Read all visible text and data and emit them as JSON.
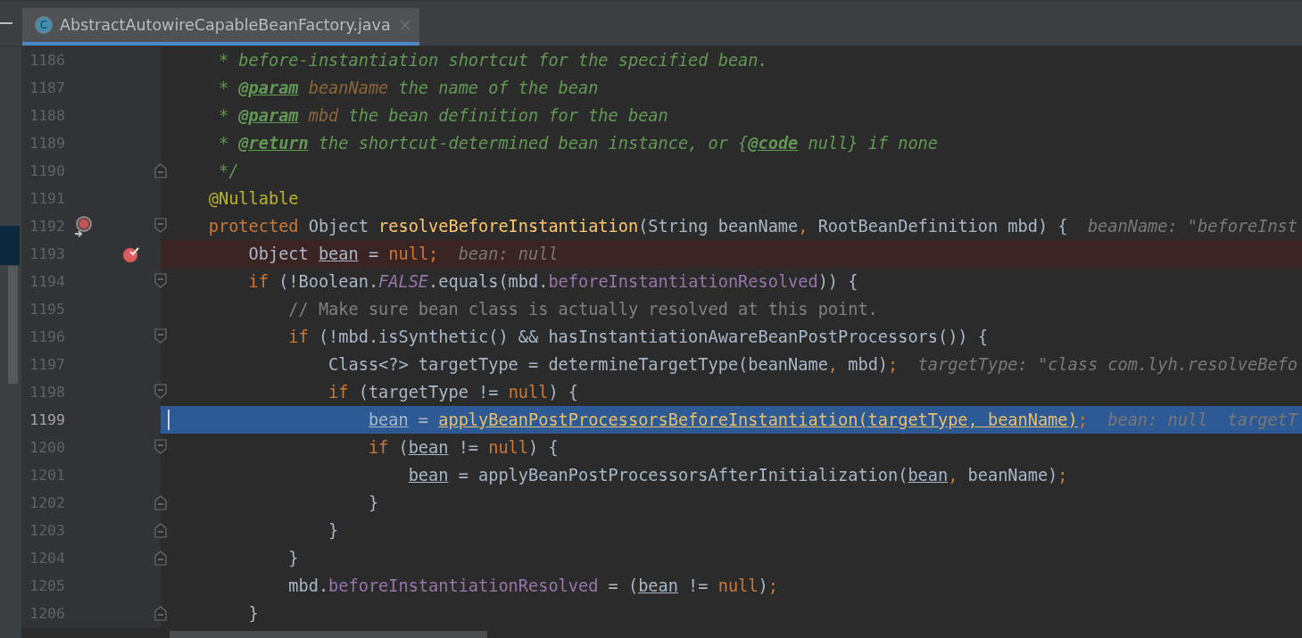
{
  "tabs": [
    {
      "label": "AbstractAutowireCapableBeanFactory.java",
      "icon_letter": "C",
      "selected": true
    }
  ],
  "lines": [
    {
      "number": "1186",
      "fold_start": false,
      "fold_end": false,
      "method_breakpoint": false,
      "breakpoint": false,
      "execution_point": false,
      "code": [
        {
          "t": "     * before-instantiation shortcut for the specified bean.",
          "kind": "doc"
        }
      ]
    },
    {
      "number": "1187",
      "fold_start": false,
      "fold_end": false,
      "method_breakpoint": false,
      "breakpoint": false,
      "execution_point": false,
      "code": [
        {
          "t": "     * ",
          "kind": "doc"
        },
        {
          "t": "@param",
          "kind": "tag"
        },
        {
          "t": " beanName",
          "kind": "docparam"
        },
        {
          "t": " the name of the bean",
          "kind": "doc"
        }
      ]
    },
    {
      "number": "1188",
      "fold_start": false,
      "fold_end": false,
      "method_breakpoint": false,
      "breakpoint": false,
      "execution_point": false,
      "code": [
        {
          "t": "     * ",
          "kind": "doc"
        },
        {
          "t": "@param",
          "kind": "tag"
        },
        {
          "t": " mbd",
          "kind": "docparam"
        },
        {
          "t": " the bean definition for the bean",
          "kind": "doc"
        }
      ]
    },
    {
      "number": "1189",
      "fold_start": false,
      "fold_end": false,
      "method_breakpoint": false,
      "breakpoint": false,
      "execution_point": false,
      "code": [
        {
          "t": "     * ",
          "kind": "doc"
        },
        {
          "t": "@return",
          "kind": "tag"
        },
        {
          "t": " the shortcut-determined bean instance, or {",
          "kind": "doc"
        },
        {
          "t": "@code",
          "kind": "tag"
        },
        {
          "t": " null} if none",
          "kind": "doc"
        }
      ]
    },
    {
      "number": "1190",
      "fold_start": false,
      "fold_end": true,
      "method_breakpoint": false,
      "breakpoint": false,
      "execution_point": false,
      "code": [
        {
          "t": "     */",
          "kind": "doc"
        }
      ]
    },
    {
      "number": "1191",
      "fold_start": false,
      "fold_end": false,
      "method_breakpoint": false,
      "breakpoint": false,
      "execution_point": false,
      "code": [
        {
          "t": "    @Nullable",
          "kind": "annot"
        }
      ]
    },
    {
      "number": "1192",
      "fold_start": true,
      "fold_end": false,
      "method_breakpoint": true,
      "breakpoint": false,
      "execution_point": false,
      "hint": "beanName: \"beforeInst",
      "code": [
        {
          "t": "    protected",
          "kind": "kw"
        },
        {
          "t": " Object ",
          "kind": "plain"
        },
        {
          "t": "resolveBeforeInstantiation",
          "kind": "decl"
        },
        {
          "t": "(String beanName",
          "kind": "plain"
        },
        {
          "t": ",",
          "kind": "kw"
        },
        {
          "t": " RootBeanDefinition mbd) {",
          "kind": "plain"
        }
      ]
    },
    {
      "number": "1193",
      "fold_start": false,
      "fold_end": false,
      "method_breakpoint": false,
      "breakpoint": true,
      "execution_point": false,
      "hint": "bean: null",
      "code": [
        {
          "t": "        Object ",
          "kind": "plain"
        },
        {
          "t": "bean",
          "kind": "var"
        },
        {
          "t": " = ",
          "kind": "plain"
        },
        {
          "t": "null;",
          "kind": "kw"
        }
      ]
    },
    {
      "number": "1194",
      "fold_start": true,
      "fold_end": false,
      "method_breakpoint": false,
      "breakpoint": false,
      "execution_point": false,
      "code": [
        {
          "t": "        if",
          "kind": "kw"
        },
        {
          "t": " (!Boolean.",
          "kind": "plain"
        },
        {
          "t": "FALSE",
          "kind": "static"
        },
        {
          "t": ".equals(mbd.",
          "kind": "plain"
        },
        {
          "t": "beforeInstantiationResolved",
          "kind": "field"
        },
        {
          "t": ")) {",
          "kind": "plain"
        }
      ]
    },
    {
      "number": "1195",
      "fold_start": false,
      "fold_end": false,
      "method_breakpoint": false,
      "breakpoint": false,
      "execution_point": false,
      "code": [
        {
          "t": "            // Make sure bean class is actually resolved at this point.",
          "kind": "comment"
        }
      ]
    },
    {
      "number": "1196",
      "fold_start": true,
      "fold_end": false,
      "method_breakpoint": false,
      "breakpoint": false,
      "execution_point": false,
      "code": [
        {
          "t": "            if",
          "kind": "kw"
        },
        {
          "t": " (!mbd.isSynthetic() && hasInstantiationAwareBeanPostProcessors()) {",
          "kind": "plain"
        }
      ]
    },
    {
      "number": "1197",
      "fold_start": false,
      "fold_end": false,
      "method_breakpoint": false,
      "breakpoint": false,
      "execution_point": false,
      "hint": "targetType: \"class com.lyh.resolveBefo",
      "code": [
        {
          "t": "                Class<?> targetType = determineTargetType(beanName",
          "kind": "plain"
        },
        {
          "t": ",",
          "kind": "kw"
        },
        {
          "t": " mbd)",
          "kind": "plain"
        },
        {
          "t": ";",
          "kind": "kw"
        }
      ]
    },
    {
      "number": "1198",
      "fold_start": true,
      "fold_end": false,
      "method_breakpoint": false,
      "breakpoint": false,
      "execution_point": false,
      "code": [
        {
          "t": "                if",
          "kind": "kw"
        },
        {
          "t": " (targetType != ",
          "kind": "plain"
        },
        {
          "t": "null",
          "kind": "kw"
        },
        {
          "t": ") {",
          "kind": "plain"
        }
      ]
    },
    {
      "number": "1199",
      "fold_start": false,
      "fold_end": false,
      "method_breakpoint": false,
      "breakpoint": false,
      "execution_point": true,
      "hint": "bean: null  targetT",
      "code": [
        {
          "t": "                    bean",
          "kind": "var"
        },
        {
          "t": " = ",
          "kind": "plain"
        },
        {
          "t": "applyBeanPostProcessorsBeforeInstantiation(targetType, beanName)",
          "kind": "target"
        },
        {
          "t": ";",
          "kind": "kw"
        }
      ]
    },
    {
      "number": "1200",
      "fold_start": true,
      "fold_end": false,
      "method_breakpoint": false,
      "breakpoint": false,
      "execution_point": false,
      "code": [
        {
          "t": "                    if",
          "kind": "kw"
        },
        {
          "t": " (",
          "kind": "plain"
        },
        {
          "t": "bean",
          "kind": "var"
        },
        {
          "t": " != ",
          "kind": "plain"
        },
        {
          "t": "null",
          "kind": "kw"
        },
        {
          "t": ") {",
          "kind": "plain"
        }
      ]
    },
    {
      "number": "1201",
      "fold_start": false,
      "fold_end": false,
      "method_breakpoint": false,
      "breakpoint": false,
      "execution_point": false,
      "code": [
        {
          "t": "                        bean",
          "kind": "var"
        },
        {
          "t": " = applyBeanPostProcessorsAfterInitialization(",
          "kind": "plain"
        },
        {
          "t": "bean",
          "kind": "var"
        },
        {
          "t": ",",
          "kind": "kw"
        },
        {
          "t": " beanName)",
          "kind": "plain"
        },
        {
          "t": ";",
          "kind": "kw"
        }
      ]
    },
    {
      "number": "1202",
      "fold_start": false,
      "fold_end": true,
      "method_breakpoint": false,
      "breakpoint": false,
      "execution_point": false,
      "code": [
        {
          "t": "                    }",
          "kind": "plain"
        }
      ]
    },
    {
      "number": "1203",
      "fold_start": false,
      "fold_end": true,
      "method_breakpoint": false,
      "breakpoint": false,
      "execution_point": false,
      "code": [
        {
          "t": "                }",
          "kind": "plain"
        }
      ]
    },
    {
      "number": "1204",
      "fold_start": false,
      "fold_end": true,
      "method_breakpoint": false,
      "breakpoint": false,
      "execution_point": false,
      "code": [
        {
          "t": "            }",
          "kind": "plain"
        }
      ]
    },
    {
      "number": "1205",
      "fold_start": false,
      "fold_end": false,
      "method_breakpoint": false,
      "breakpoint": false,
      "execution_point": false,
      "code": [
        {
          "t": "            mbd.",
          "kind": "plain"
        },
        {
          "t": "beforeInstantiationResolved",
          "kind": "field"
        },
        {
          "t": " = (",
          "kind": "plain"
        },
        {
          "t": "bean",
          "kind": "var"
        },
        {
          "t": " != ",
          "kind": "plain"
        },
        {
          "t": "null",
          "kind": "kw"
        },
        {
          "t": ")",
          "kind": "plain"
        },
        {
          "t": ";",
          "kind": "kw"
        }
      ]
    },
    {
      "number": "1206",
      "fold_start": false,
      "fold_end": true,
      "method_breakpoint": false,
      "breakpoint": false,
      "execution_point": false,
      "code": [
        {
          "t": "        }",
          "kind": "plain"
        }
      ]
    }
  ]
}
